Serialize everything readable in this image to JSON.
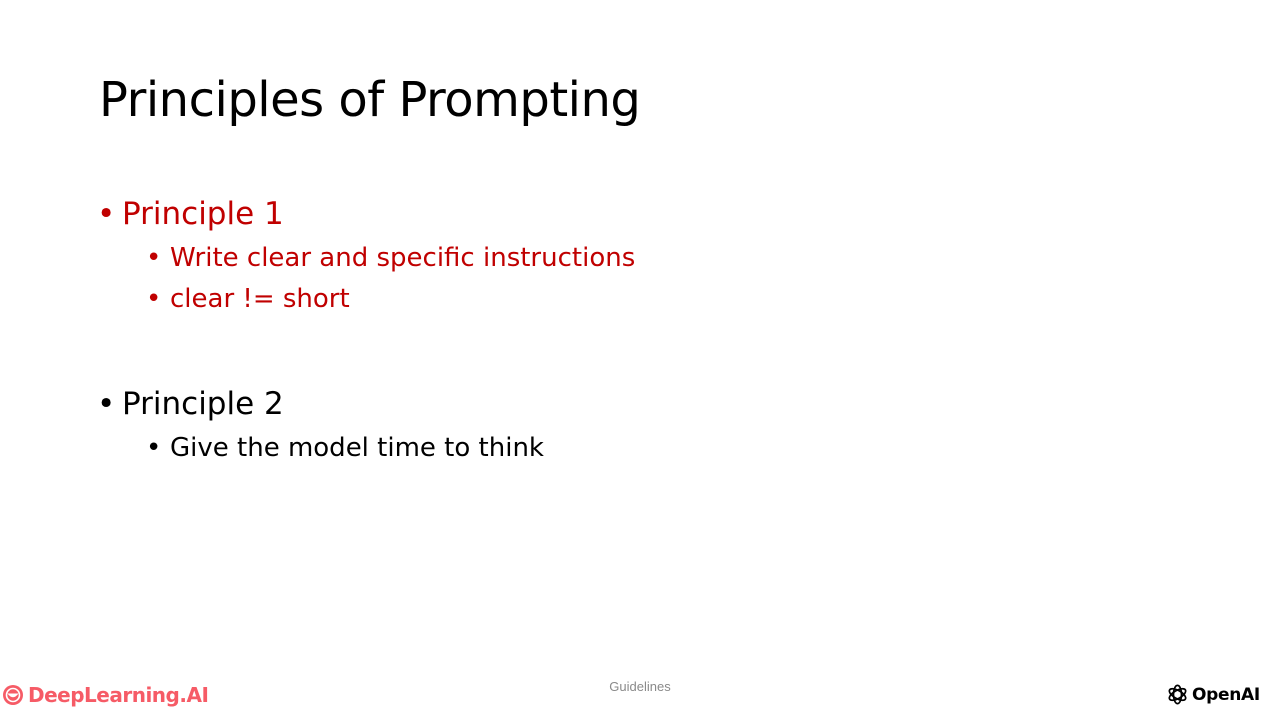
{
  "slide": {
    "title": "Principles of Prompting",
    "bullet_char": "•",
    "principles": [
      {
        "label": "Principle 1",
        "color": "#C00000",
        "items": [
          "Write clear and specific instructions",
          "clear != short"
        ]
      },
      {
        "label": "Principle 2",
        "color": "#000000",
        "items": [
          "Give the model time to think"
        ]
      }
    ]
  },
  "footer": {
    "center_text": "Guidelines",
    "left_logo": {
      "text": "DeepLearning.AI",
      "icon": "deeplearning-ai-logo-icon",
      "color": "#F65B66"
    },
    "right_logo": {
      "text": "OpenAI",
      "icon": "openai-logo-icon",
      "color": "#000000"
    }
  }
}
